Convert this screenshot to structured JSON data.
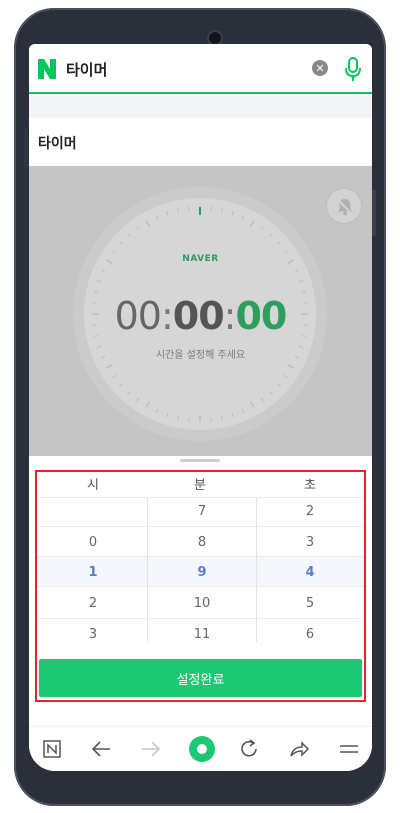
{
  "search": {
    "query": "타이머"
  },
  "section": {
    "title": "타이머"
  },
  "timer": {
    "brand": "NAVER",
    "hours": "00",
    "minutes": "00",
    "seconds": "00",
    "hint": "시간을 설정해 주세요"
  },
  "picker": {
    "headers": [
      "시",
      "분",
      "초"
    ],
    "columns": {
      "hours": [
        "",
        "0",
        "1",
        "2",
        "3"
      ],
      "minutes": [
        "7",
        "8",
        "9",
        "10",
        "11"
      ],
      "seconds": [
        "2",
        "3",
        "4",
        "5",
        "6"
      ]
    },
    "selected": {
      "hours": "1",
      "minutes": "9",
      "seconds": "4"
    },
    "confirm_label": "설정완료"
  },
  "colors": {
    "brand_green": "#03c75a",
    "confirm_green": "#1dc872",
    "selected_blue": "#5a7fc0",
    "highlight_red": "#e3242b"
  },
  "icons": {
    "logo": "naver-n-logo",
    "clear": "clear-icon",
    "mic": "mic-icon",
    "sound_off": "bell-off-icon",
    "nav": [
      "naver-home-icon",
      "back-arrow-icon",
      "forward-arrow-icon",
      "green-dot-icon",
      "refresh-icon",
      "share-icon",
      "menu-icon"
    ]
  }
}
